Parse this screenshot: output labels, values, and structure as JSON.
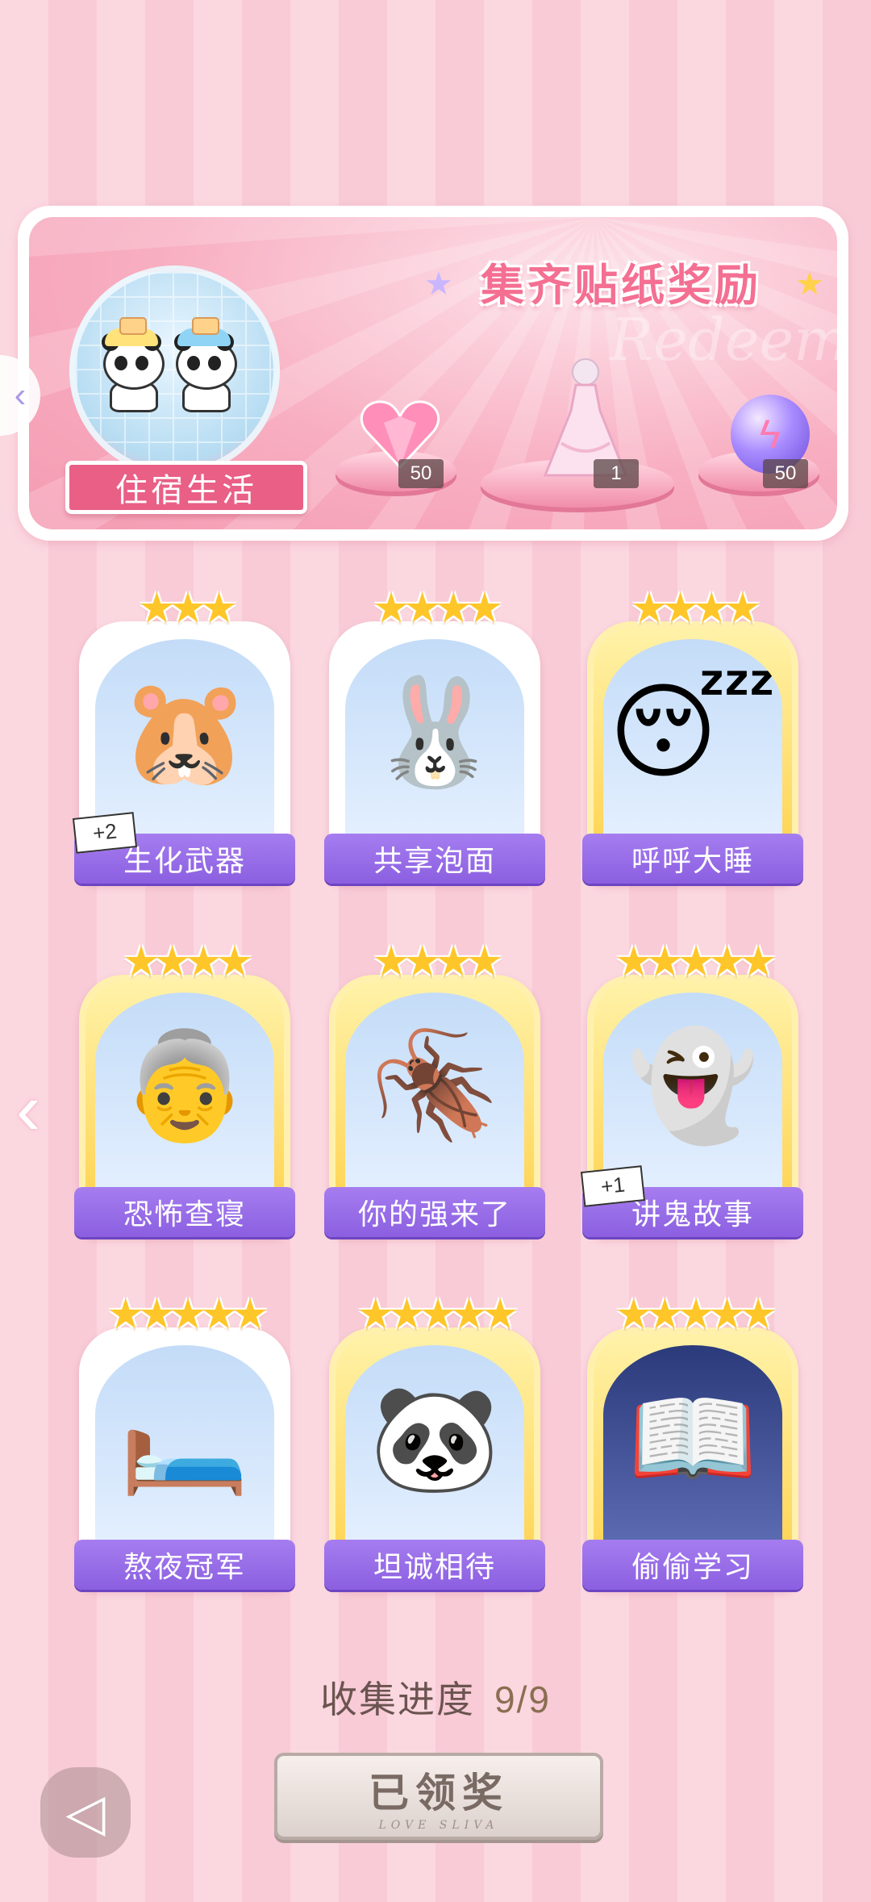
{
  "banner": {
    "title": "集齐贴纸奖励",
    "watermark": "Redeem",
    "sticker_label": "住宿生活",
    "rewards": [
      {
        "name": "heart-gem",
        "count": "50"
      },
      {
        "name": "dress",
        "count": "1"
      },
      {
        "name": "energy-orb",
        "count": "50"
      }
    ]
  },
  "cards": [
    {
      "label": "生化武器",
      "stars": "★★★",
      "badge": "+2",
      "image": "capybara-sock-icon"
    },
    {
      "label": "共享泡面",
      "stars": "★★★★",
      "badge": "",
      "image": "bunny-noodles-icon"
    },
    {
      "label": "呼呼大睡",
      "stars": "★★★★",
      "badge": "",
      "image": "sleeping-boy-icon"
    },
    {
      "label": "恐怖查寝",
      "stars": "★★★★",
      "badge": "",
      "image": "dorm-auntie-icon"
    },
    {
      "label": "你的强来了",
      "stars": "★★★★",
      "badge": "",
      "image": "cockroach-icon"
    },
    {
      "label": "讲鬼故事",
      "stars": "★★★★★",
      "badge": "+1",
      "image": "ghost-boy-icon"
    },
    {
      "label": "熬夜冠军",
      "stars": "★★★★★",
      "badge": "",
      "image": "phone-in-bed-icon"
    },
    {
      "label": "坦诚相待",
      "stars": "★★★★★",
      "badge": "",
      "image": "bathing-pandas-icon"
    },
    {
      "label": "偷偷学习",
      "stars": "★★★★★",
      "badge": "",
      "image": "study-under-blanket-icon"
    }
  ],
  "progress": {
    "label": "收集进度",
    "value": "9/9"
  },
  "claim_button": {
    "label": "已领奖",
    "sub": "LOVE SLIVA"
  },
  "icons": {
    "nav_prev": "‹",
    "back": "◁"
  }
}
